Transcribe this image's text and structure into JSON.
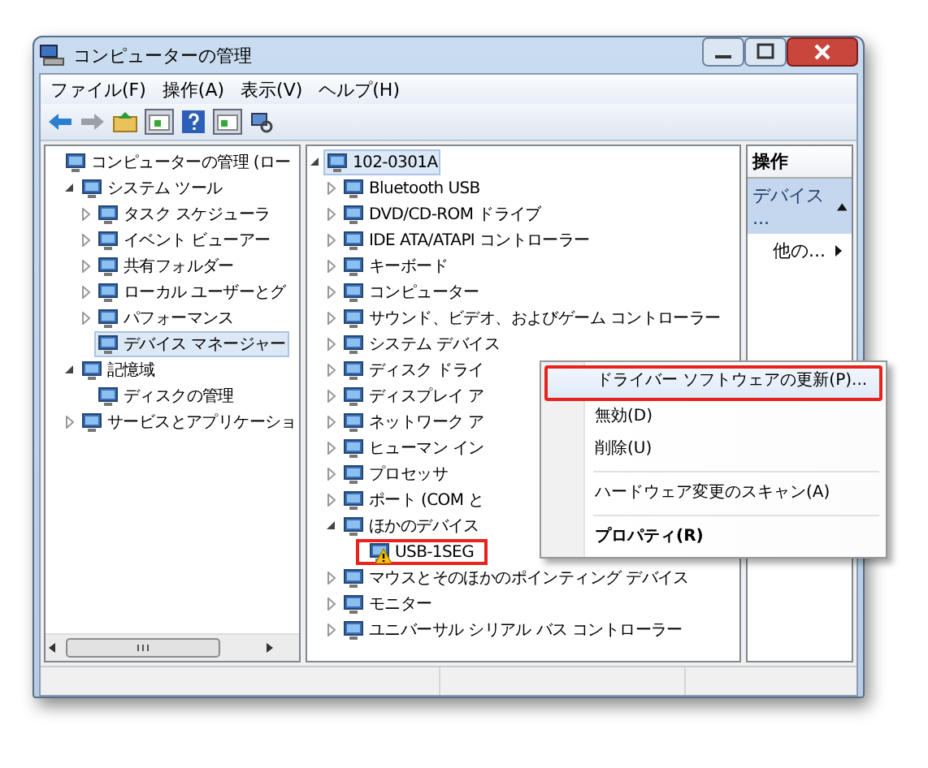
{
  "window": {
    "title": "コンピューターの管理"
  },
  "menu_bar": [
    "ファイル(F)",
    "操作(A)",
    "表示(V)",
    "ヘルプ(H)"
  ],
  "nav_tree": [
    {
      "label": "コンピューターの管理 (ロー",
      "selected": false,
      "children": [
        {
          "label": "システム ツール",
          "expanded": true,
          "selected": false,
          "children": [
            {
              "label": "タスク スケジューラ",
              "expanded": false,
              "selected": false
            },
            {
              "label": "イベント ビューアー",
              "expanded": false,
              "selected": false
            },
            {
              "label": "共有フォルダー",
              "expanded": false,
              "selected": false
            },
            {
              "label": "ローカル ユーザーとグ",
              "expanded": false,
              "selected": false
            },
            {
              "label": "パフォーマンス",
              "expanded": false,
              "selected": false
            },
            {
              "label": "デバイス マネージャー",
              "selected": true
            }
          ]
        },
        {
          "label": "記憶域",
          "expanded": true,
          "selected": false,
          "children": [
            {
              "label": "ディスクの管理",
              "selected": false
            }
          ]
        },
        {
          "label": "サービスとアプリケーショ",
          "expanded": false,
          "selected": false
        }
      ]
    }
  ],
  "device_tree": [
    {
      "label": "102-0301A",
      "expanded": true,
      "selected": true,
      "children": [
        {
          "label": "Bluetooth USB",
          "expanded": false,
          "selected": false
        },
        {
          "label": "DVD/CD-ROM ドライブ",
          "expanded": false,
          "selected": false
        },
        {
          "label": "IDE ATA/ATAPI コントローラー",
          "expanded": false,
          "selected": false
        },
        {
          "label": "キーボード",
          "expanded": false,
          "selected": false
        },
        {
          "label": "コンピューター",
          "expanded": false,
          "selected": false
        },
        {
          "label": "サウンド、ビデオ、およびゲーム コントローラー",
          "expanded": false,
          "selected": false
        },
        {
          "label": "システム デバイス",
          "expanded": false,
          "selected": false
        },
        {
          "label": "ディスク ドライ",
          "expanded": false,
          "selected": false
        },
        {
          "label": "ディスプレイ ア",
          "expanded": false,
          "selected": false
        },
        {
          "label": "ネットワーク ア",
          "expanded": false,
          "selected": false
        },
        {
          "label": "ヒューマン イン",
          "expanded": false,
          "selected": false
        },
        {
          "label": "プロセッサ",
          "expanded": false,
          "selected": false
        },
        {
          "label": "ポート (COM と",
          "expanded": false,
          "selected": false
        },
        {
          "label": "ほかのデバイス",
          "expanded": true,
          "selected": false,
          "children": [
            {
              "label": "USB-1SEG",
              "selected": false,
              "warning": true,
              "highlighted": true
            }
          ]
        },
        {
          "label": "マウスとそのほかのポインティング デバイス",
          "expanded": false,
          "selected": false
        },
        {
          "label": "モニター",
          "expanded": false,
          "selected": false
        },
        {
          "label": "ユニバーサル シリアル バス コントローラー",
          "expanded": false,
          "selected": false
        }
      ]
    }
  ],
  "actions": {
    "header": "操作",
    "section": {
      "label": "デバイス ...",
      "expanded": true
    },
    "items": [
      {
        "label": "他の..."
      }
    ]
  },
  "context_menu": [
    {
      "kind": "item",
      "label": "ドライバー ソフトウェアの更新(P)...",
      "bold": false,
      "hovered": true,
      "highlighted": true
    },
    {
      "kind": "item",
      "label": "無効(D)",
      "bold": false,
      "hovered": false,
      "highlighted": false
    },
    {
      "kind": "item",
      "label": "削除(U)",
      "bold": false,
      "hovered": false,
      "highlighted": false
    },
    {
      "kind": "separator"
    },
    {
      "kind": "item",
      "label": "ハードウェア変更のスキャン(A)",
      "bold": false,
      "hovered": false,
      "highlighted": false
    },
    {
      "kind": "separator"
    },
    {
      "kind": "item",
      "label": "プロパティ(R)",
      "bold": true,
      "hovered": false,
      "highlighted": false
    }
  ]
}
